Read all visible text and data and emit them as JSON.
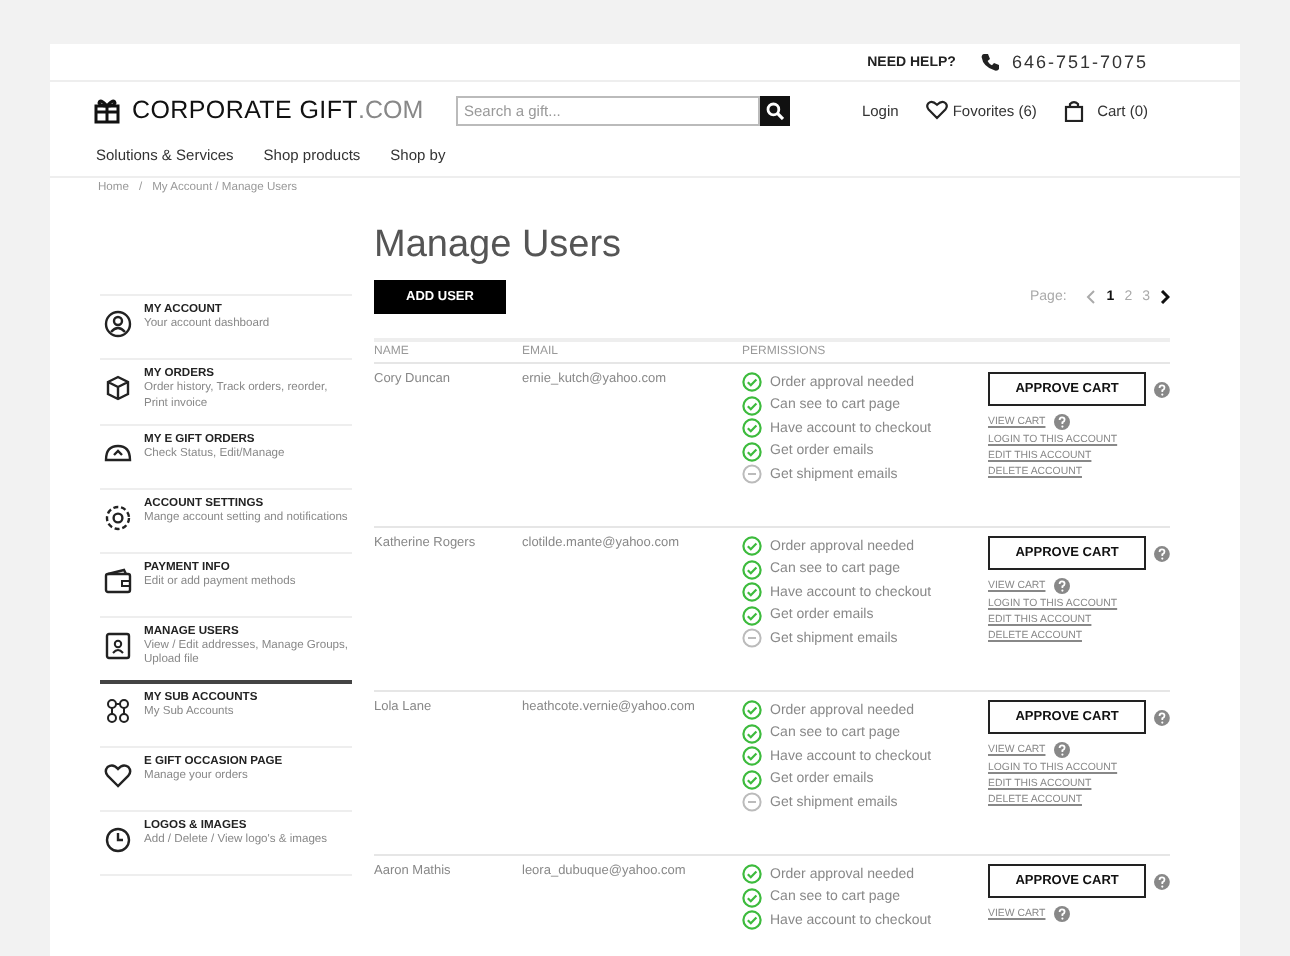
{
  "top_bar": {
    "help": "NEED HELP?",
    "phone": "646-751-7075"
  },
  "header": {
    "logo_main": "CORPORATE GIFT",
    "logo_suffix": ".COM",
    "search": {
      "placeholder": "Search a gift..."
    },
    "login": "Login",
    "favorites": "Fovorites (6)",
    "cart": "Cart (0)"
  },
  "nav": [
    "Solutions & Services",
    "Shop products",
    "Shop by"
  ],
  "breadcrumb": {
    "separator": "/",
    "items": [
      "Home",
      "My Account / Manage Users"
    ]
  },
  "sidebar": {
    "items": [
      {
        "title": "MY ACCOUNT",
        "subtitle": "Your account dashboard",
        "selected": false
      },
      {
        "title": "MY ORDERS",
        "subtitle": "Order history, Track orders, reorder, Print invoice",
        "selected": false
      },
      {
        "title": "MY E GIFT ORDERS",
        "subtitle": "Check Status, Edit/Manage",
        "selected": false
      },
      {
        "title": "ACCOUNT SETTINGS",
        "subtitle": "Mange account setting and notifications",
        "selected": false
      },
      {
        "title": "PAYMENT INFO",
        "subtitle": "Edit or add payment methods",
        "selected": false
      },
      {
        "title": "MANAGE USERS",
        "subtitle": "View / Edit addresses, Manage Groups, Upload file",
        "selected": true
      },
      {
        "title": "MY SUB ACCOUNTS",
        "subtitle": "My Sub Accounts",
        "selected": false
      },
      {
        "title": "E GIFT OCCASION PAGE",
        "subtitle": "Manage your orders",
        "selected": false
      },
      {
        "title": "LOGOS & IMAGES",
        "subtitle": "Add / Delete / View logo's & images",
        "selected": false
      }
    ]
  },
  "page_title": "Manage Users",
  "add_button": "ADD USER",
  "pagination": {
    "label": "Page:",
    "pages": [
      {
        "label": "1",
        "selected": true
      },
      {
        "label": "2",
        "selected": false
      },
      {
        "label": "3",
        "selected": false
      }
    ]
  },
  "table": {
    "columns": [
      "NAME",
      "EMAIL",
      "PERMISSIONS"
    ],
    "rows": [
      {
        "name": "Cory Duncan",
        "email": "ernie_kutch@yahoo.com",
        "permissions": [
          {
            "label": "Order approval needed",
            "enabled": true
          },
          {
            "label": "Can see to cart page",
            "enabled": true
          },
          {
            "label": "Have account to checkout",
            "enabled": true
          },
          {
            "label": "Get order emails",
            "enabled": true
          },
          {
            "label": "Get shipment emails",
            "enabled": false
          }
        ],
        "button": "APPROVE CART",
        "links": [
          "VIEW CART",
          "LOGIN TO THIS ACCOUNT",
          "EDIT THIS ACCOUNT",
          "DELETE ACCOUNT"
        ]
      },
      {
        "name": "Katherine Rogers",
        "email": "clotilde.mante@yahoo.com",
        "permissions": [
          {
            "label": "Order approval needed",
            "enabled": true
          },
          {
            "label": "Can see to cart page",
            "enabled": true
          },
          {
            "label": "Have account to checkout",
            "enabled": true
          },
          {
            "label": "Get order emails",
            "enabled": true
          },
          {
            "label": "Get shipment emails",
            "enabled": false
          }
        ],
        "button": "APPROVE CART",
        "links": [
          "VIEW CART",
          "LOGIN TO THIS ACCOUNT",
          "EDIT THIS ACCOUNT",
          "DELETE ACCOUNT"
        ]
      },
      {
        "name": "Lola Lane",
        "email": "heathcote.vernie@yahoo.com",
        "permissions": [
          {
            "label": "Order approval needed",
            "enabled": true
          },
          {
            "label": "Can see to cart page",
            "enabled": true
          },
          {
            "label": "Have account to checkout",
            "enabled": true
          },
          {
            "label": "Get order emails",
            "enabled": true
          },
          {
            "label": "Get shipment emails",
            "enabled": false
          }
        ],
        "button": "APPROVE CART",
        "links": [
          "VIEW CART",
          "LOGIN TO THIS ACCOUNT",
          "EDIT THIS ACCOUNT",
          "DELETE ACCOUNT"
        ]
      },
      {
        "name": "Aaron Mathis",
        "email": "leora_dubuque@yahoo.com",
        "permissions": [
          {
            "label": "Order approval needed",
            "enabled": true
          },
          {
            "label": "Can see to cart page",
            "enabled": true
          },
          {
            "label": "Have account to checkout",
            "enabled": true
          }
        ],
        "button": "APPROVE CART",
        "links": [
          "VIEW CART"
        ]
      }
    ]
  }
}
